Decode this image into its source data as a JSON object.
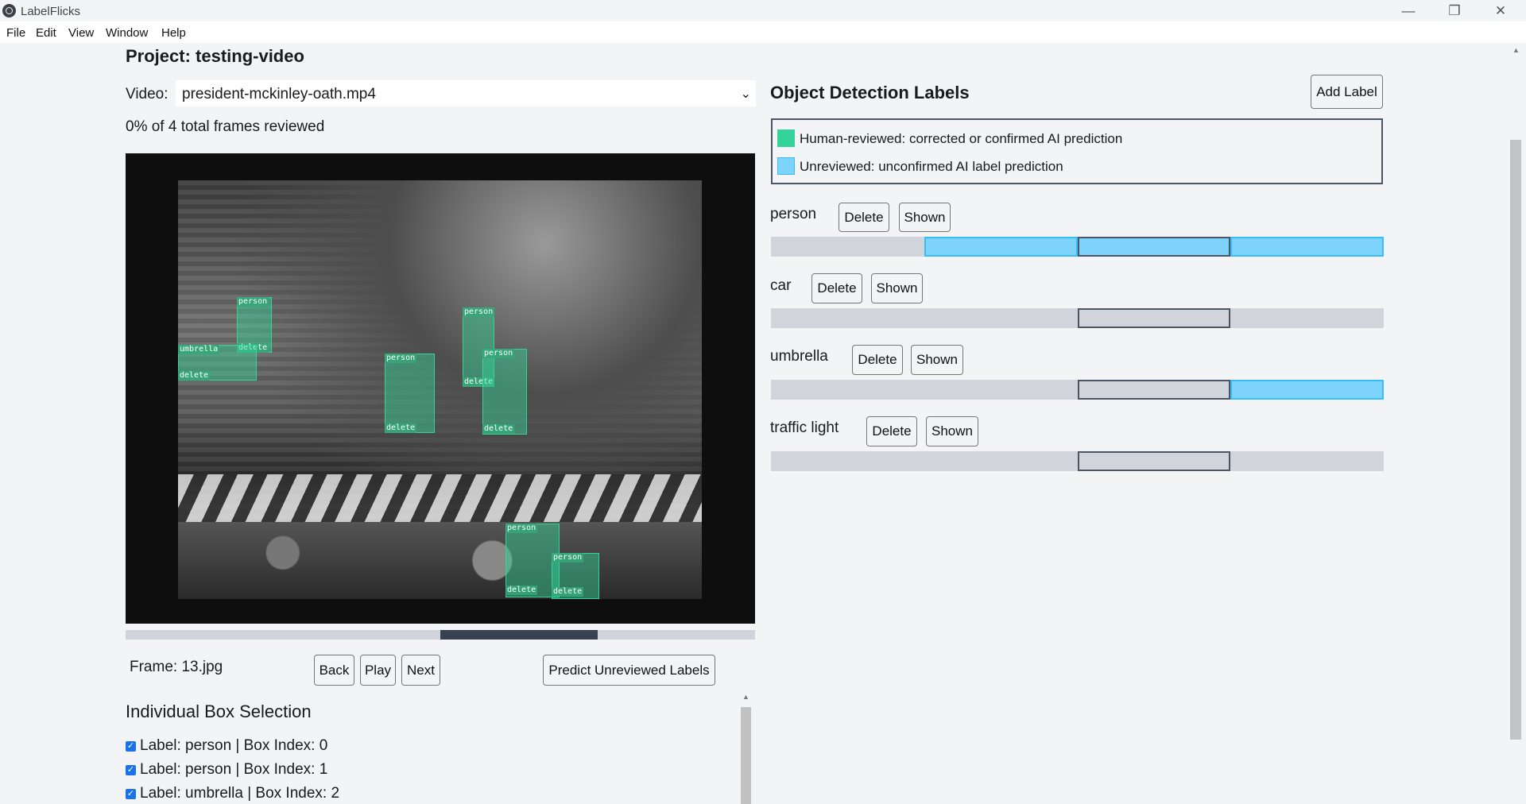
{
  "window": {
    "title": "LabelFlicks",
    "minimize_glyph": "—",
    "restore_glyph": "❐",
    "close_glyph": "✕"
  },
  "menu": [
    "File",
    "Edit",
    "View",
    "Window",
    "Help"
  ],
  "project": {
    "title": "Project: testing-video"
  },
  "video": {
    "label": "Video:",
    "selected": "president-mckinley-oath.mp4",
    "caret": "⌄",
    "progress": "0% of 4 total frames reviewed",
    "scrubber_position_fraction": 0.5
  },
  "boxes": [
    {
      "label": "person",
      "delete": "delete"
    },
    {
      "label": "umbrella",
      "delete": "delete"
    },
    {
      "label": "person",
      "delete": "delete"
    },
    {
      "label": "person",
      "delete": "delete"
    },
    {
      "label": "person",
      "delete": "delete"
    },
    {
      "label": "person",
      "delete": "delete"
    },
    {
      "label": "person",
      "delete": "delete"
    }
  ],
  "controls": {
    "frame": "Frame: 13.jpg",
    "back": "Back",
    "play": "Play",
    "next": "Next",
    "predict": "Predict Unreviewed Labels"
  },
  "individual_selection": {
    "title": "Individual Box Selection",
    "items": [
      "Label: person | Box Index: 0",
      "Label: person | Box Index: 1",
      "Label: umbrella | Box Index: 2"
    ]
  },
  "labels_panel": {
    "title": "Object Detection Labels",
    "add_button": "Add Label",
    "legend": [
      {
        "text": "Human-reviewed: corrected or confirmed AI prediction",
        "color": "#34d399"
      },
      {
        "text": "Unreviewed: unconfirmed AI label prediction",
        "color": "#7dd3fc"
      }
    ],
    "delete_label": "Delete",
    "shown_label": "Shown",
    "labels": [
      {
        "name": "person",
        "frames": [
          "none",
          "unreviewed",
          "unreviewed-selected",
          "unreviewed"
        ]
      },
      {
        "name": "car",
        "frames": [
          "none",
          "none",
          "selected",
          "none"
        ]
      },
      {
        "name": "umbrella",
        "frames": [
          "none",
          "none",
          "selected",
          "unreviewed"
        ]
      },
      {
        "name": "traffic light",
        "frames": [
          "none",
          "none",
          "selected",
          "none"
        ]
      }
    ]
  },
  "colors": {
    "reviewed": "#34d399",
    "unreviewed": "#7dd3fc",
    "scrubber": "#374151"
  }
}
